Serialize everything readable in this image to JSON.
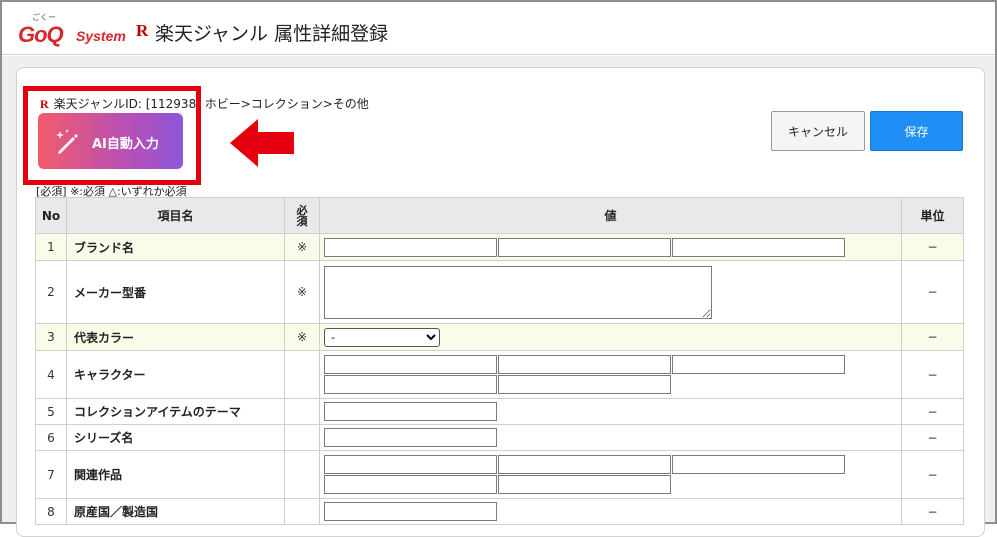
{
  "header": {
    "logo_kana": "ごくー",
    "logo_text": "GoQ",
    "logo_system": "System",
    "rakuten_mark": "R",
    "title": "楽天ジャンル 属性詳細登録"
  },
  "breadcrumb": {
    "mark": "R",
    "text": "楽天ジャンルID: [112938] ホビー>コレクション>その他"
  },
  "ai_button": {
    "label": "AI自動入力"
  },
  "actions": {
    "cancel_label": "キャンセル",
    "save_label": "保存"
  },
  "legend": "[必須] ※:必須 △:いずれか必須",
  "table": {
    "headers": {
      "no": "No",
      "name": "項目名",
      "required": "必須",
      "value": "値",
      "unit": "単位"
    },
    "rows": [
      {
        "no": "1",
        "name": "ブランド名",
        "required": "※",
        "unit": "−"
      },
      {
        "no": "2",
        "name": "メーカー型番",
        "required": "※",
        "unit": "−"
      },
      {
        "no": "3",
        "name": "代表カラー",
        "required": "※",
        "unit": "−",
        "select_value": "-"
      },
      {
        "no": "4",
        "name": "キャラクター",
        "required": "",
        "unit": "−"
      },
      {
        "no": "5",
        "name": "コレクションアイテムのテーマ",
        "required": "",
        "unit": "−"
      },
      {
        "no": "6",
        "name": "シリーズ名",
        "required": "",
        "unit": "−"
      },
      {
        "no": "7",
        "name": "関連作品",
        "required": "",
        "unit": "−"
      },
      {
        "no": "8",
        "name": "原産国／製造国",
        "required": "",
        "unit": "−"
      }
    ]
  },
  "colors": {
    "brand_red": "#d7262e",
    "save_blue": "#1f8ef5",
    "highlight_row": "#fbfbea",
    "annotation_red": "#e4000f"
  }
}
